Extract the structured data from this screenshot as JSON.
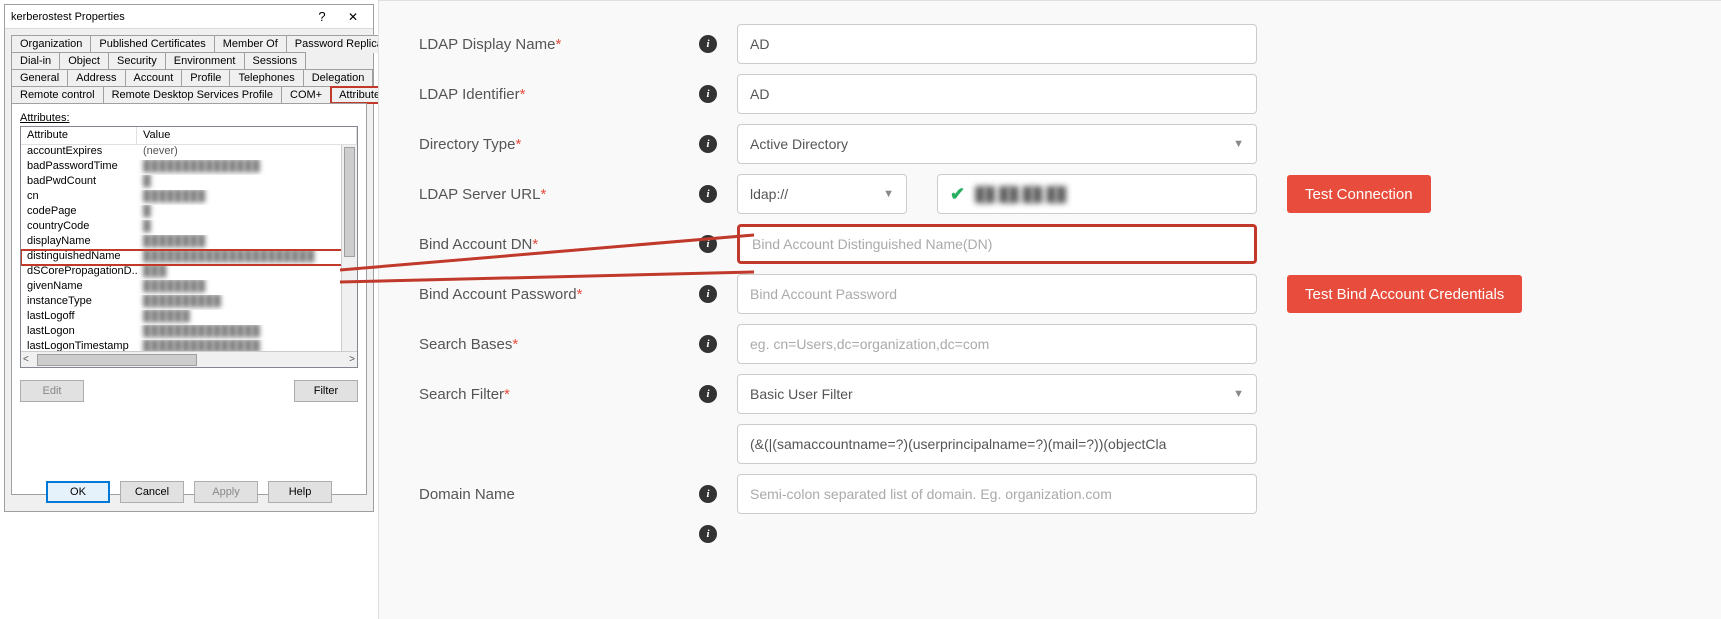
{
  "dialog": {
    "title": "kerberostest Properties",
    "help": "?",
    "close": "✕",
    "tabrows": [
      [
        "Organization",
        "Published Certificates",
        "Member Of",
        "Password Replication"
      ],
      [
        "Dial-in",
        "Object",
        "Security",
        "Environment",
        "Sessions"
      ],
      [
        "General",
        "Address",
        "Account",
        "Profile",
        "Telephones",
        "Delegation"
      ],
      [
        "Remote control",
        "Remote Desktop Services Profile",
        "COM+",
        "Attribute Editor"
      ]
    ],
    "highlight_tab": "Attribute Editor",
    "attributes_label": "Attributes:",
    "col_attribute": "Attribute",
    "col_value": "Value",
    "rows": [
      {
        "a": "accountExpires",
        "v": "(never)",
        "blur": false
      },
      {
        "a": "badPasswordTime",
        "v": "███████████████",
        "blur": true
      },
      {
        "a": "badPwdCount",
        "v": "█",
        "blur": true
      },
      {
        "a": "cn",
        "v": "████████",
        "blur": true
      },
      {
        "a": "codePage",
        "v": "█",
        "blur": true
      },
      {
        "a": "countryCode",
        "v": "█",
        "blur": true
      },
      {
        "a": "displayName",
        "v": "████████",
        "blur": true
      },
      {
        "a": "distinguishedName",
        "v": "██████████████████████",
        "blur": true,
        "hl": true
      },
      {
        "a": "dSCorePropagationD...",
        "v": "███",
        "blur": true
      },
      {
        "a": "givenName",
        "v": "████████",
        "blur": true
      },
      {
        "a": "instanceType",
        "v": "██████████",
        "blur": true
      },
      {
        "a": "lastLogoff",
        "v": "██████",
        "blur": true
      },
      {
        "a": "lastLogon",
        "v": "███████████████",
        "blur": true
      },
      {
        "a": "lastLogonTimestamp",
        "v": "███████████████",
        "blur": true
      }
    ],
    "btn_edit": "Edit",
    "btn_filter": "Filter",
    "btn_ok": "OK",
    "btn_cancel": "Cancel",
    "btn_apply": "Apply",
    "btn_help": "Help"
  },
  "form": {
    "ldap_display_name": {
      "label": "LDAP Display Name",
      "value": "AD"
    },
    "ldap_identifier": {
      "label": "LDAP Identifier",
      "value": "AD"
    },
    "directory_type": {
      "label": "Directory Type",
      "value": "Active Directory"
    },
    "ldap_server_url": {
      "label": "LDAP Server URL",
      "proto": "ldap://",
      "host": "██.██.██.██"
    },
    "bind_dn": {
      "label": "Bind Account DN",
      "placeholder": "Bind Account Distinguished Name(DN)"
    },
    "bind_pw": {
      "label": "Bind Account Password",
      "placeholder": "Bind Account Password"
    },
    "search_bases": {
      "label": "Search Bases",
      "placeholder": "eg. cn=Users,dc=organization,dc=com"
    },
    "search_filter": {
      "label": "Search Filter",
      "value": "Basic User Filter",
      "expr": "(&(|(samaccountname=?)(userprincipalname=?)(mail=?))(objectCla"
    },
    "domain_name": {
      "label": "Domain Name",
      "placeholder": "Semi-colon separated list of domain. Eg. organization.com"
    },
    "btn_test_conn": "Test Connection",
    "btn_test_bind": "Test Bind Account Credentials"
  }
}
